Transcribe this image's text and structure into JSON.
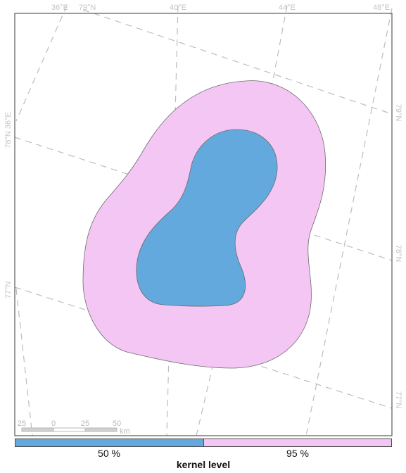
{
  "map": {
    "lon_labels_top": [
      "36°E",
      "40°E",
      "44°E",
      "48°E"
    ],
    "lat_label_top": "79°N",
    "left_labels": [
      "78°N 36°E",
      "77°N"
    ],
    "right_labels": [
      "79°N",
      "78°N",
      "77°N"
    ],
    "scalebar": {
      "labels": [
        "25",
        "0",
        "25",
        "50"
      ],
      "unit": "km"
    }
  },
  "legend": {
    "title": "kernel level",
    "items": [
      {
        "label": "50 %",
        "color": "#64a9de"
      },
      {
        "label": "95 %",
        "color": "#f4c6f4"
      }
    ]
  },
  "colors": {
    "outer_fill": "#f4c6f4",
    "inner_fill": "#64a9de",
    "outline": "#6b6b6b",
    "graticule": "#bdbdbd",
    "panel_border": "#5a5a5a"
  }
}
